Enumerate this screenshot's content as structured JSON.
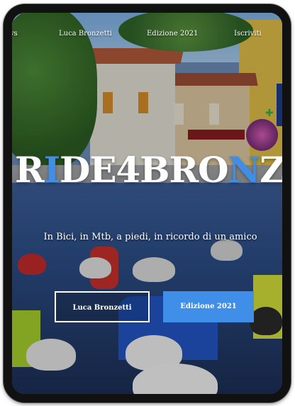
{
  "nav": {
    "items": [
      {
        "label": "ws"
      },
      {
        "label": "Luca Bronzetti"
      },
      {
        "label": "Edizione 2021"
      },
      {
        "label": "Iscriviti"
      }
    ]
  },
  "hero": {
    "title_parts": [
      "R",
      "I",
      "DE4BRO",
      "N",
      "Z"
    ],
    "subtitle": "In Bici, in Mtb, a piedi, in ricordo di un amico",
    "button_primary": "Luca Bronzetti",
    "button_secondary": "Edizione 2021"
  },
  "colors": {
    "accent": "#3f8fe8",
    "text": "#ffffff"
  }
}
